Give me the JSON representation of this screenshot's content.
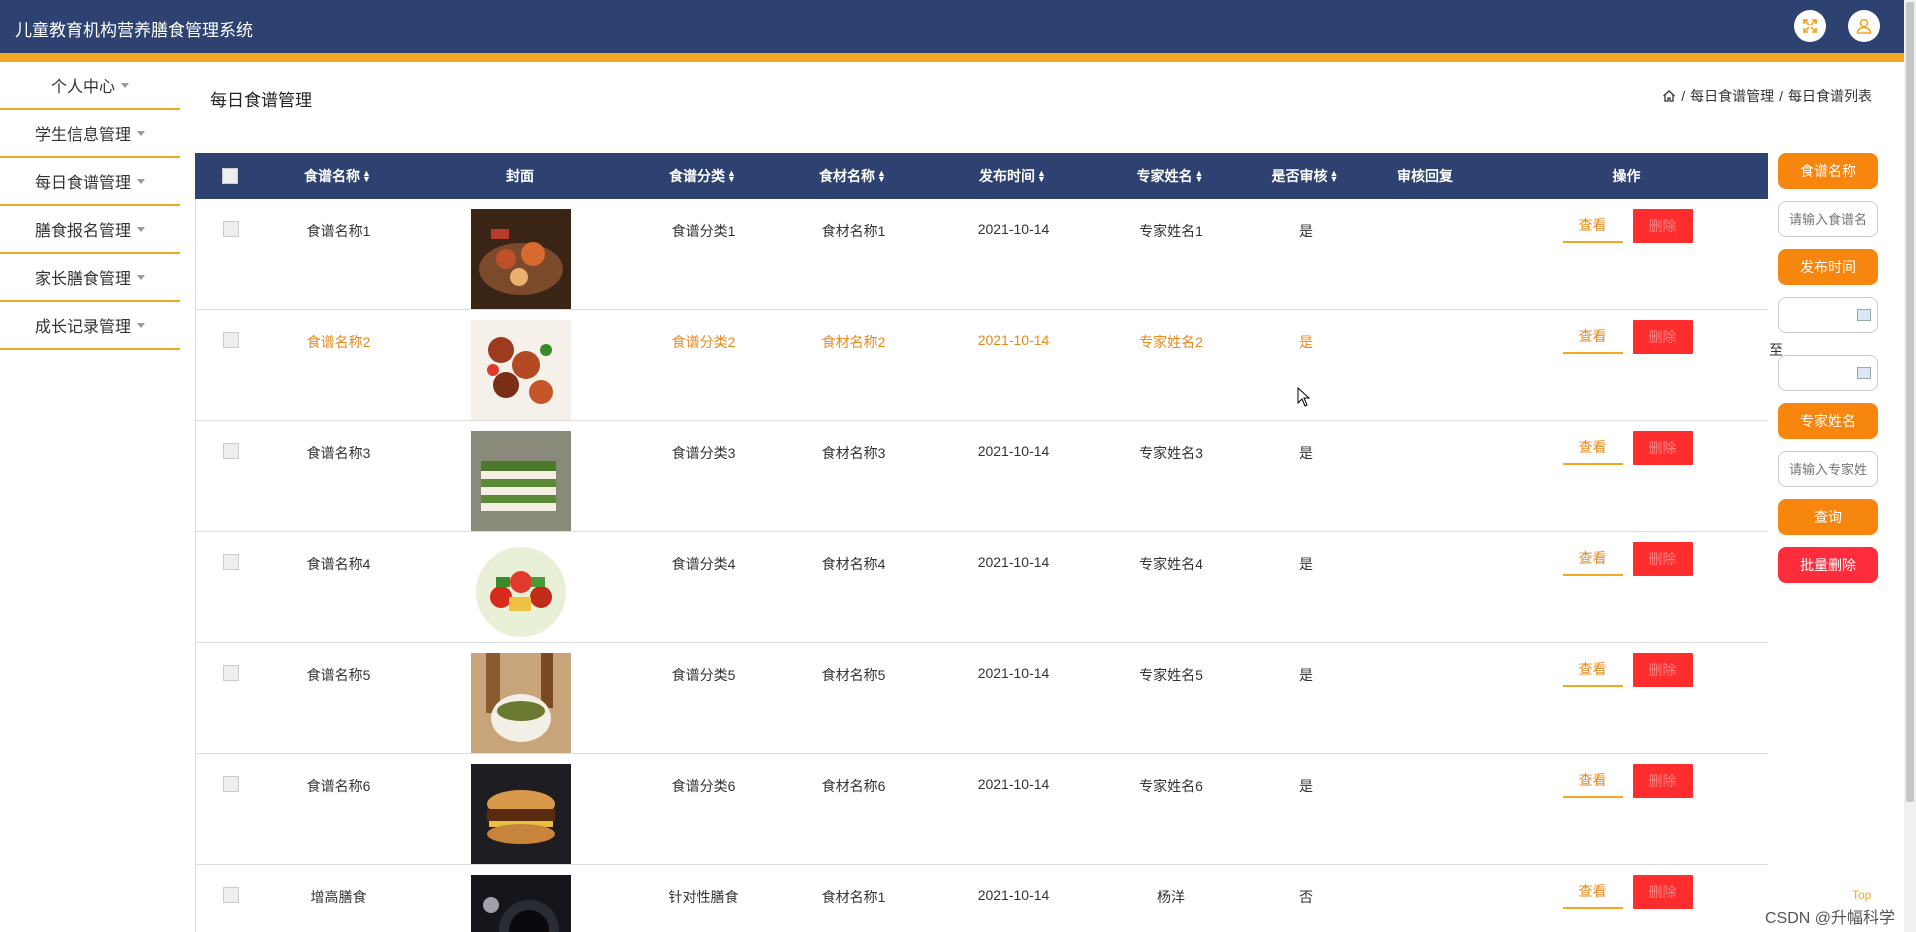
{
  "header": {
    "title": "儿童教育机构营养膳食管理系统",
    "icons": [
      "fullscreen-icon",
      "user-icon"
    ],
    "bg_color": "#2d4270",
    "accent_color": "#f5a623"
  },
  "sidebar": {
    "items": [
      {
        "label": "个人中心"
      },
      {
        "label": "学生信息管理"
      },
      {
        "label": "每日食谱管理"
      },
      {
        "label": "膳食报名管理"
      },
      {
        "label": "家长膳食管理"
      },
      {
        "label": "成长记录管理"
      }
    ]
  },
  "page": {
    "title": "每日食谱管理",
    "breadcrumb": [
      "每日食谱管理",
      "每日食谱列表"
    ],
    "breadcrumb_sep": "/"
  },
  "table": {
    "headers": {
      "name": "食谱名称",
      "cover": "封面",
      "category": "食谱分类",
      "ingredient": "食材名称",
      "date": "发布时间",
      "expert": "专家姓名",
      "audited": "是否审核",
      "reply": "审核回复",
      "ops": "操作"
    },
    "view_label": "查看",
    "delete_label": "删除",
    "rows": [
      {
        "name": "食谱名称1",
        "category": "食谱分类1",
        "ingredient": "食材名称1",
        "date": "2021-10-14",
        "expert": "专家姓名1",
        "audited": "是",
        "reply": "",
        "cover": "seafood-platter"
      },
      {
        "name": "食谱名称2",
        "category": "食谱分类2",
        "ingredient": "食材名称2",
        "date": "2021-10-14",
        "expert": "专家姓名2",
        "audited": "是",
        "reply": "",
        "cover": "grilled-skewers"
      },
      {
        "name": "食谱名称3",
        "category": "食谱分类3",
        "ingredient": "食材名称3",
        "date": "2021-10-14",
        "expert": "专家姓名3",
        "audited": "是",
        "reply": "",
        "cover": "matcha-cake"
      },
      {
        "name": "食谱名称4",
        "category": "食谱分类4",
        "ingredient": "食材名称4",
        "date": "2021-10-14",
        "expert": "专家姓名4",
        "audited": "是",
        "reply": "",
        "cover": "veggie-skewers"
      },
      {
        "name": "食谱名称5",
        "category": "食谱分类5",
        "ingredient": "食材名称5",
        "date": "2021-10-14",
        "expert": "专家姓名5",
        "audited": "是",
        "reply": "",
        "cover": "soup-bowl"
      },
      {
        "name": "食谱名称6",
        "category": "食谱分类6",
        "ingredient": "食材名称6",
        "date": "2021-10-14",
        "expert": "专家姓名6",
        "audited": "是",
        "reply": "",
        "cover": "burger"
      },
      {
        "name": "增高膳食",
        "category": "针对性膳食",
        "ingredient": "食材名称1",
        "date": "2021-10-14",
        "expert": "杨洋",
        "audited": "否",
        "reply": "",
        "cover": "dark-plate"
      }
    ]
  },
  "search": {
    "name_label": "食谱名称",
    "name_placeholder": "请输入食谱名称",
    "date_label": "发布时间",
    "to_label": "至",
    "expert_label": "专家姓名",
    "expert_placeholder": "请输入专家姓名",
    "query_label": "查询",
    "batch_delete_label": "批量删除"
  },
  "footer": {
    "top_link": "Top",
    "watermark": "CSDN @升幅科学"
  }
}
